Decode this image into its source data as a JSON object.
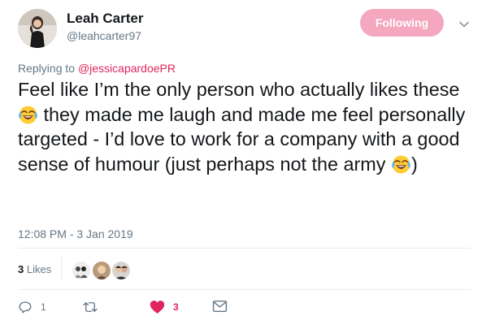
{
  "user": {
    "name": "Leah Carter",
    "handle": "@leahcarter97"
  },
  "follow_button": {
    "label": "Following",
    "color": "#f4a7bf"
  },
  "reply": {
    "prefix": "Replying to ",
    "mention": "@jessicapardoePR",
    "mention_color": "#e0245e"
  },
  "tweet": {
    "part1": "Feel like I’m the only person who actually likes these ",
    "part2": " they made me laugh and made me feel personally targeted - I’d love to work for a company with a good sense of humour (just perhaps not the army ",
    "part3": ")",
    "emoji_name": "face-with-tears-of-joy-icon",
    "timestamp": "12:08 PM - 3 Jan 2019"
  },
  "likes": {
    "count": "3",
    "label": "Likes"
  },
  "actions": {
    "reply_count": "1",
    "retweet_count": "",
    "like_count": "3",
    "like_color": "#e0245e"
  }
}
